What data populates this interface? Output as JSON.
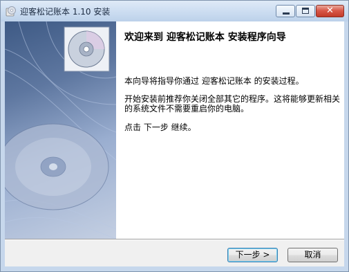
{
  "window": {
    "title": "迎客松记账本 1.10 安装"
  },
  "icons": {
    "app": "installer-cd-icon",
    "minimize": "minimize-icon",
    "maximize": "maximize-icon",
    "close": "close-icon",
    "banner_disc": "cd-disc-icon"
  },
  "main": {
    "heading": "欢迎来到 迎客松记账本 安装程序向导",
    "paragraph1": "本向导将指导你通过 迎客松记账本 的安装过程。",
    "paragraph2": "开始安装前推荐你关闭全部其它的程序。这将能够更新相关的系统文件不需要重启你的电脑。",
    "paragraph3": "点击 下一步 继续。"
  },
  "buttons": {
    "next": "下一步 >",
    "cancel": "取消"
  },
  "colors": {
    "titlebar": "#cfdff2",
    "close_button": "#c23a28",
    "side_panel": "#5e77a0",
    "accent_focus": "#3c7fb1"
  }
}
